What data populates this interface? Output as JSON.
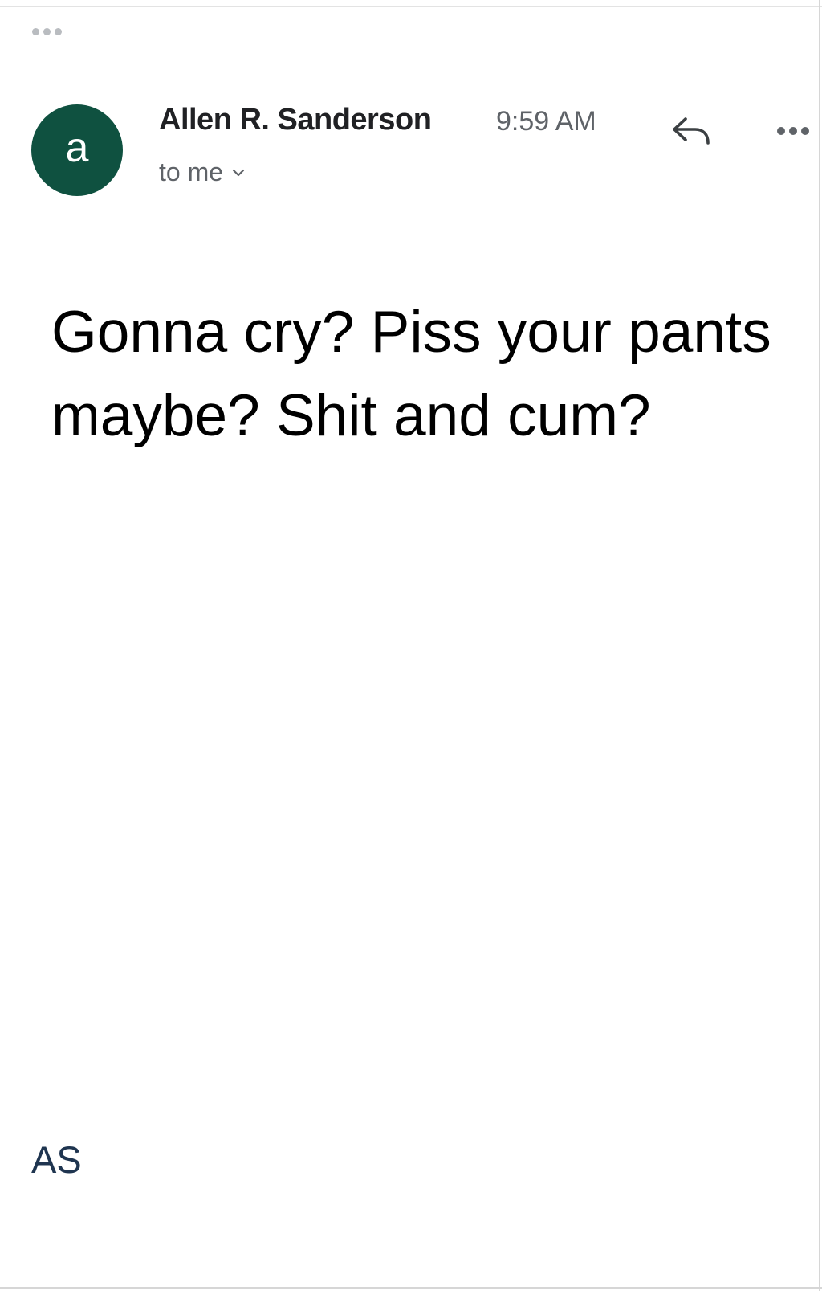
{
  "email": {
    "sender_initial": "a",
    "sender_name": "Allen R. Sanderson",
    "time": "9:59 AM",
    "recipient_label": "to me",
    "message": "Gonna cry? Piss your pants maybe? Shit and cum?",
    "signature": "AS"
  },
  "colors": {
    "avatar_bg": "#0f5140",
    "sender_text": "#202124",
    "secondary_text": "#5f6368",
    "signature_text": "#1f3550"
  },
  "icons": {
    "top_menu": "more-horizontal-icon",
    "reply": "reply-icon",
    "more": "more-horizontal-icon",
    "recipient_toggle": "chevron-down-icon"
  }
}
